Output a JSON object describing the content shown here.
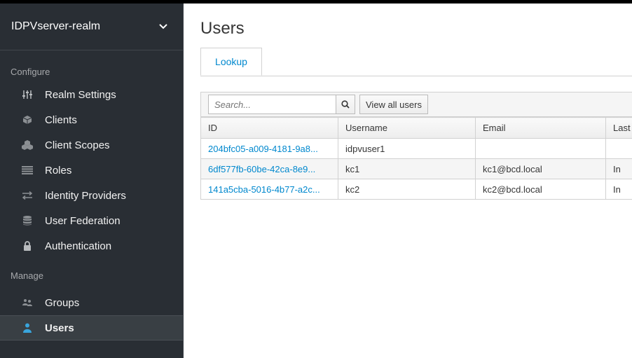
{
  "realm": {
    "name": "IDPVserver-realm",
    "chevron_icon": "chevron-down-icon"
  },
  "sidebar": {
    "configure_title": "Configure",
    "configure_items": [
      {
        "label": "Realm Settings",
        "icon": "sliders-icon"
      },
      {
        "label": "Clients",
        "icon": "cube-icon"
      },
      {
        "label": "Client Scopes",
        "icon": "cubes-icon"
      },
      {
        "label": "Roles",
        "icon": "list-icon"
      },
      {
        "label": "Identity Providers",
        "icon": "exchange-icon"
      },
      {
        "label": "User Federation",
        "icon": "database-icon"
      },
      {
        "label": "Authentication",
        "icon": "lock-icon"
      }
    ],
    "manage_title": "Manage",
    "manage_items": [
      {
        "label": "Groups",
        "icon": "users-icon"
      },
      {
        "label": "Users",
        "icon": "user-icon",
        "active": true
      }
    ]
  },
  "main": {
    "title": "Users",
    "tabs": [
      {
        "label": "Lookup",
        "active": true
      }
    ],
    "search": {
      "placeholder": "Search..."
    },
    "view_all_label": "View all users",
    "columns": [
      "ID",
      "Username",
      "Email",
      "Last Name"
    ],
    "rows": [
      {
        "id": "204bfc05-a009-4181-9a8...",
        "username": "idpvuser1",
        "email": "",
        "last": ""
      },
      {
        "id": "6df577fb-60be-42ca-8e9...",
        "username": "kc1",
        "email": "kc1@bcd.local",
        "last": "In"
      },
      {
        "id": "141a5cba-5016-4b77-a2c...",
        "username": "kc2",
        "email": "kc2@bcd.local",
        "last": "In"
      }
    ]
  },
  "colors": {
    "sidebar_bg": "#292e34",
    "link": "#0088ce",
    "active_user_icon": "#39a5dc"
  }
}
